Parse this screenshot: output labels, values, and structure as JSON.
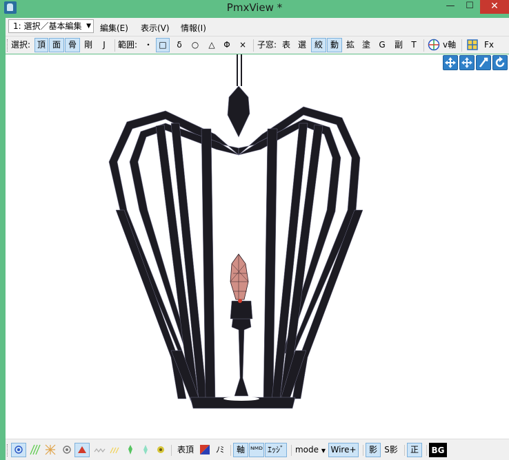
{
  "window": {
    "title": "PmxView *",
    "buttons": {
      "minimize": "—",
      "maximize": "☐",
      "close": "✕"
    },
    "accent_color": "#5fbf86"
  },
  "menubar": {
    "mode_select": "1: 選択／基本編集",
    "items": [
      "編集(E)",
      "表示(V)",
      "情報(I)"
    ]
  },
  "toolbar": {
    "select_label": "選択:",
    "select_buttons": [
      "頂",
      "面",
      "骨",
      "剛",
      "J"
    ],
    "range_label": "範囲:",
    "range_buttons": [
      "・",
      "□",
      "δ",
      "○",
      "△",
      "Φ",
      "×"
    ],
    "subwin_label": "子窓:",
    "subwin_buttons": [
      "表",
      "選",
      "絞",
      "動",
      "拡",
      "塗",
      "G",
      "副",
      "T"
    ],
    "axis_label": "v軸",
    "fx_label": "Fx"
  },
  "viewport": {
    "nav_icons": [
      "move-xy-icon",
      "move-all-icon",
      "rotate-axis-icon",
      "rotate-view-icon"
    ],
    "background": "#ffffff",
    "model_color": "#1c1b22",
    "wire_color": "#6f6f8a",
    "flame_color": "#d08f86"
  },
  "statusbar": {
    "vertex_label": "表頂",
    "bone_label": "ﾉﾐ",
    "axis_label": "軸",
    "nmd_label": "ᴺᴹᴰ",
    "edge_label": "ｴｯｼﾞ",
    "mode_label": "mode",
    "wire_label": "Wire+",
    "shadow_label": "影",
    "sshadow_label": "S影",
    "front_label": "正",
    "bg_label": "BG"
  }
}
